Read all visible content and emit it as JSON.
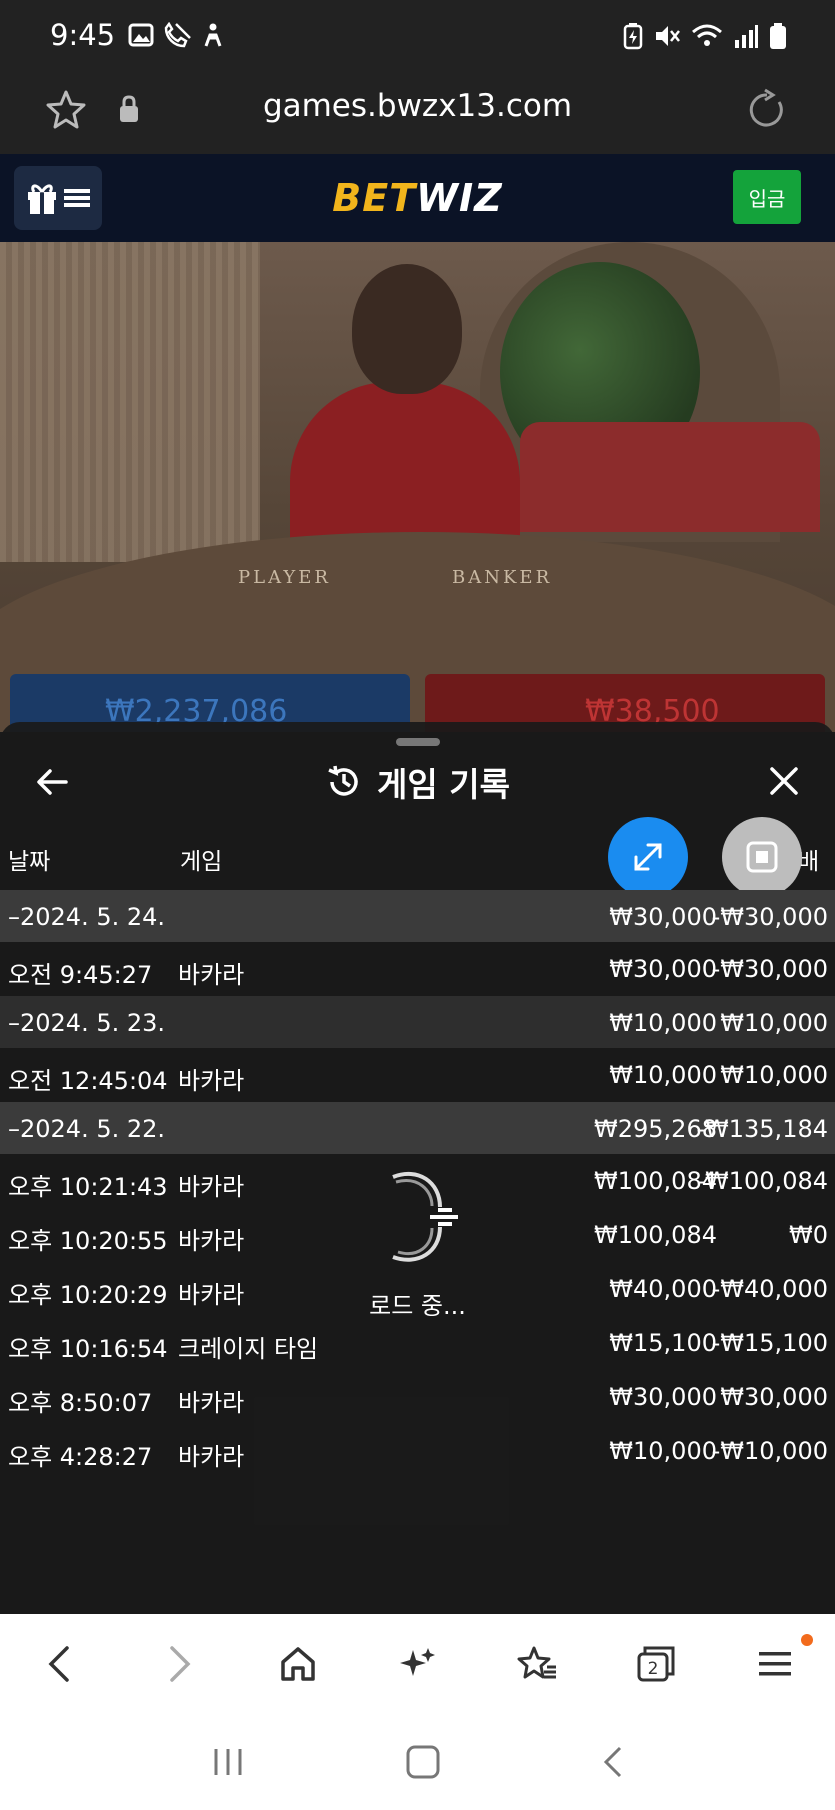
{
  "status_bar": {
    "time": "9:45",
    "left_icons": [
      "image-icon",
      "no-call-icon",
      "accessibility-icon"
    ],
    "right_icons": [
      "battery-saver-icon",
      "mute-icon",
      "wifi-icon",
      "signal-icon",
      "battery-icon"
    ]
  },
  "browser": {
    "url": "games.bwzx13.com"
  },
  "site": {
    "logo_part1": "BET",
    "logo_part2": "WIZ",
    "deposit_label": "입금"
  },
  "video": {
    "table_player_label": "PLAYER",
    "table_banker_label": "BANKER",
    "player_amount": "₩2,237,086",
    "banker_amount": "₩38,500"
  },
  "panel": {
    "title": "게임 기록",
    "columns": {
      "date": "날짜",
      "game": "게임",
      "payout": "배"
    },
    "rows": [
      {
        "type": "date",
        "c1": "–2024. 5. 24.",
        "c2": "",
        "c3": "₩30,000",
        "c4": "-₩30,000"
      },
      {
        "type": "item",
        "c1": "오전 9:45:27",
        "c2": "바카라",
        "c3": "₩30,000",
        "c4": "-₩30,000"
      },
      {
        "type": "date",
        "c1": "–2024. 5. 23.",
        "c2": "",
        "c3": "₩10,000",
        "c4": "₩10,000"
      },
      {
        "type": "item",
        "c1": "오전 12:45:04",
        "c2": "바카라",
        "c3": "₩10,000",
        "c4": "₩10,000"
      },
      {
        "type": "date",
        "c1": "–2024. 5. 22.",
        "c2": "",
        "c3": "₩295,268",
        "c4": "-₩135,184"
      },
      {
        "type": "item",
        "c1": "오후 10:21:43",
        "c2": "바카라",
        "c3": "₩100,084",
        "c4": "-₩100,084"
      },
      {
        "type": "item",
        "c1": "오후 10:20:55",
        "c2": "바카라",
        "c3": "₩100,084",
        "c4": "₩0"
      },
      {
        "type": "item",
        "c1": "오후 10:20:29",
        "c2": "바카라",
        "c3": "₩40,000",
        "c4": "-₩40,000"
      },
      {
        "type": "item",
        "c1": "오후 10:16:54",
        "c2": "크레이지 타임",
        "c3": "₩15,100",
        "c4": "-₩15,100"
      },
      {
        "type": "item",
        "c1": "오후 8:50:07",
        "c2": "바카라",
        "c3": "₩30,000",
        "c4": "₩30,000"
      },
      {
        "type": "item",
        "c1": "오후 4:28:27",
        "c2": "바카라",
        "c3": "₩10,000",
        "c4": "-₩10,000"
      }
    ],
    "loading_text": "로드 중..."
  },
  "bottom_nav": {
    "items": [
      "back-icon",
      "forward-icon",
      "home-icon",
      "ai-sparkle-icon",
      "bookmarks-icon",
      "tabs-icon",
      "menu-icon"
    ],
    "tab_count": "2"
  },
  "colors": {
    "accent_blue": "#1a8cf0",
    "deposit_green": "#14a33b",
    "logo_gold": "#f2b51c",
    "badge_orange": "#f26b1d"
  }
}
